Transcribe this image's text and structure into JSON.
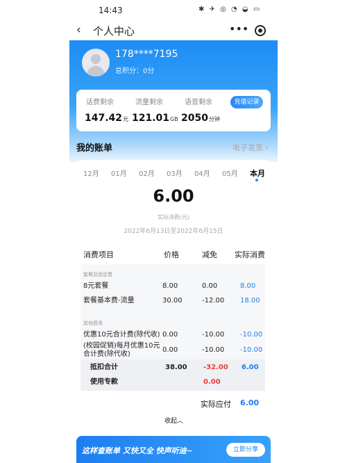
{
  "status_bar": {
    "time": "14:43",
    "icons_text": "✱ ✈ ◎ ◔ ◒ ▭"
  },
  "nav": {
    "title": "个人中心",
    "back_icon": "chevron-left-icon",
    "more_icon": "more-dots-icon",
    "target_icon": "target-icon"
  },
  "profile": {
    "phone": "178****7195",
    "points_label": "总积分：",
    "points_value": "0分"
  },
  "balances": {
    "items": [
      {
        "label": "话费剩余",
        "value": "147.42",
        "unit": "元"
      },
      {
        "label": "流量剩余",
        "value": "121.01",
        "unit": "GB"
      },
      {
        "label": "语音剩余",
        "value": "2050",
        "unit": "分钟"
      }
    ],
    "recharge_label": "充值记录"
  },
  "bill": {
    "title": "我的账单",
    "einvoice_label": "电子发票",
    "einvoice_chevron": "›",
    "months": [
      "12月",
      "01月",
      "02月",
      "03月",
      "04月",
      "05月",
      "本月"
    ],
    "active_month_index": 6,
    "amount": "6.00",
    "amount_label": "实际消费(元)",
    "period": "2022年6月13日至2022年6月15日",
    "headers": [
      "消费项目",
      "价格",
      "减免",
      "实际消费"
    ],
    "groups": [
      {
        "label": "套餐及固定费",
        "rows": [
          {
            "item": "8元套餐",
            "price": "8.00",
            "discount": "0.00",
            "actual": "8.00"
          },
          {
            "item": "套餐基本费-流量",
            "price": "30.00",
            "discount": "-12.00",
            "actual": "18.00"
          }
        ]
      },
      {
        "label": "其他费用",
        "rows": [
          {
            "item": "优惠10元合计费(除代收)",
            "price": "0.00",
            "discount": "-10.00",
            "actual": "-10.00"
          },
          {
            "item": "(校园促销)每月优惠10元合计费(除代收)",
            "price": "0.00",
            "discount": "-10.00",
            "actual": "-10.00"
          }
        ]
      }
    ],
    "deduction": {
      "label": "抵扣合计",
      "price": "38.00",
      "discount": "-32.00",
      "actual": "6.00"
    },
    "special": {
      "label": "使用专款",
      "discount": "0.00"
    },
    "actual_due_label": "实际应付",
    "actual_due_value": "6.00",
    "collapse_label": "收起",
    "collapse_chevron": "︿"
  },
  "promo": {
    "text": "这样查账单 又快又全 快声听迪~",
    "share_label": "立即分享"
  },
  "colors": {
    "brand_blue": "#1d8cf5",
    "value_blue": "#1f7fe8",
    "discount_red": "#ee3b3b"
  }
}
